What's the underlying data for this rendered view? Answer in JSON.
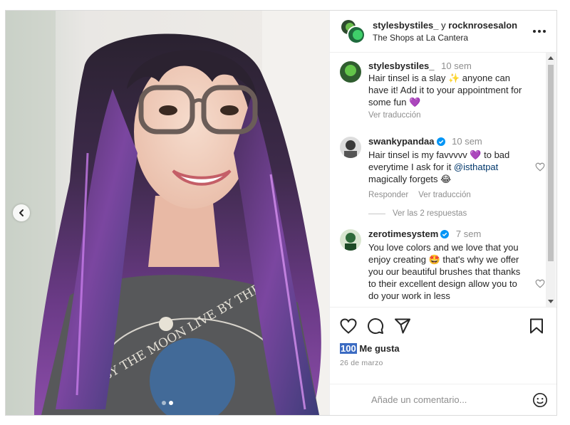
{
  "post": {
    "header": {
      "user1": "stylesbystiles_",
      "conjunction": "y",
      "user2": "rocknrosesalon",
      "location": "The Shops at La Cantera"
    },
    "photo": {
      "shirt_text": "BY THE MOON LIVE BY THE",
      "carousel_dots": 2,
      "active_dot": 1
    },
    "comments": [
      {
        "user": "stylesbystiles_",
        "verified": false,
        "time": "10 sem",
        "text_before": "Hair tinsel is a slay ",
        "emoji1": "✨",
        "text_after": " anyone can have it! Add it to your appointment for some fun ",
        "emoji2": "💜",
        "translate": "Ver traducción"
      },
      {
        "user": "swankypandaa",
        "verified": true,
        "time": "10 sem",
        "text_before": "Hair tinsel is my favvvvv ",
        "emoji1": "💜",
        "text_mid": " to bad everytime I ask for it ",
        "mention": "@isthatpat",
        "text_after": " magically forgets ",
        "emoji2": "😂",
        "reply": "Responder",
        "translate": "Ver traducción",
        "view_replies": "Ver las 2 respuestas"
      },
      {
        "user": "zerotimesystem",
        "verified": true,
        "time": "7 sem",
        "text_before": "You love colors and we love that you enjoy creating ",
        "emoji1": "🤩",
        "text_after": " that's why we offer you our beautiful brushes that thanks to their excellent design allow you to do your work in less"
      }
    ],
    "likes_count": "100",
    "likes_label": " Me gusta",
    "date": "26 de marzo",
    "add_comment_placeholder": "Añade un comentario...",
    "icons": {
      "more": "more-horizontal-icon",
      "like": "heart-icon",
      "comment": "comment-bubble-icon",
      "share": "paper-plane-icon",
      "save": "bookmark-icon",
      "emoji": "smiley-icon",
      "prev": "chevron-left-icon"
    },
    "colors": {
      "verified": "#0095f6",
      "secondary_text": "#8e8e8e",
      "selection": "#3b6bc2"
    }
  }
}
